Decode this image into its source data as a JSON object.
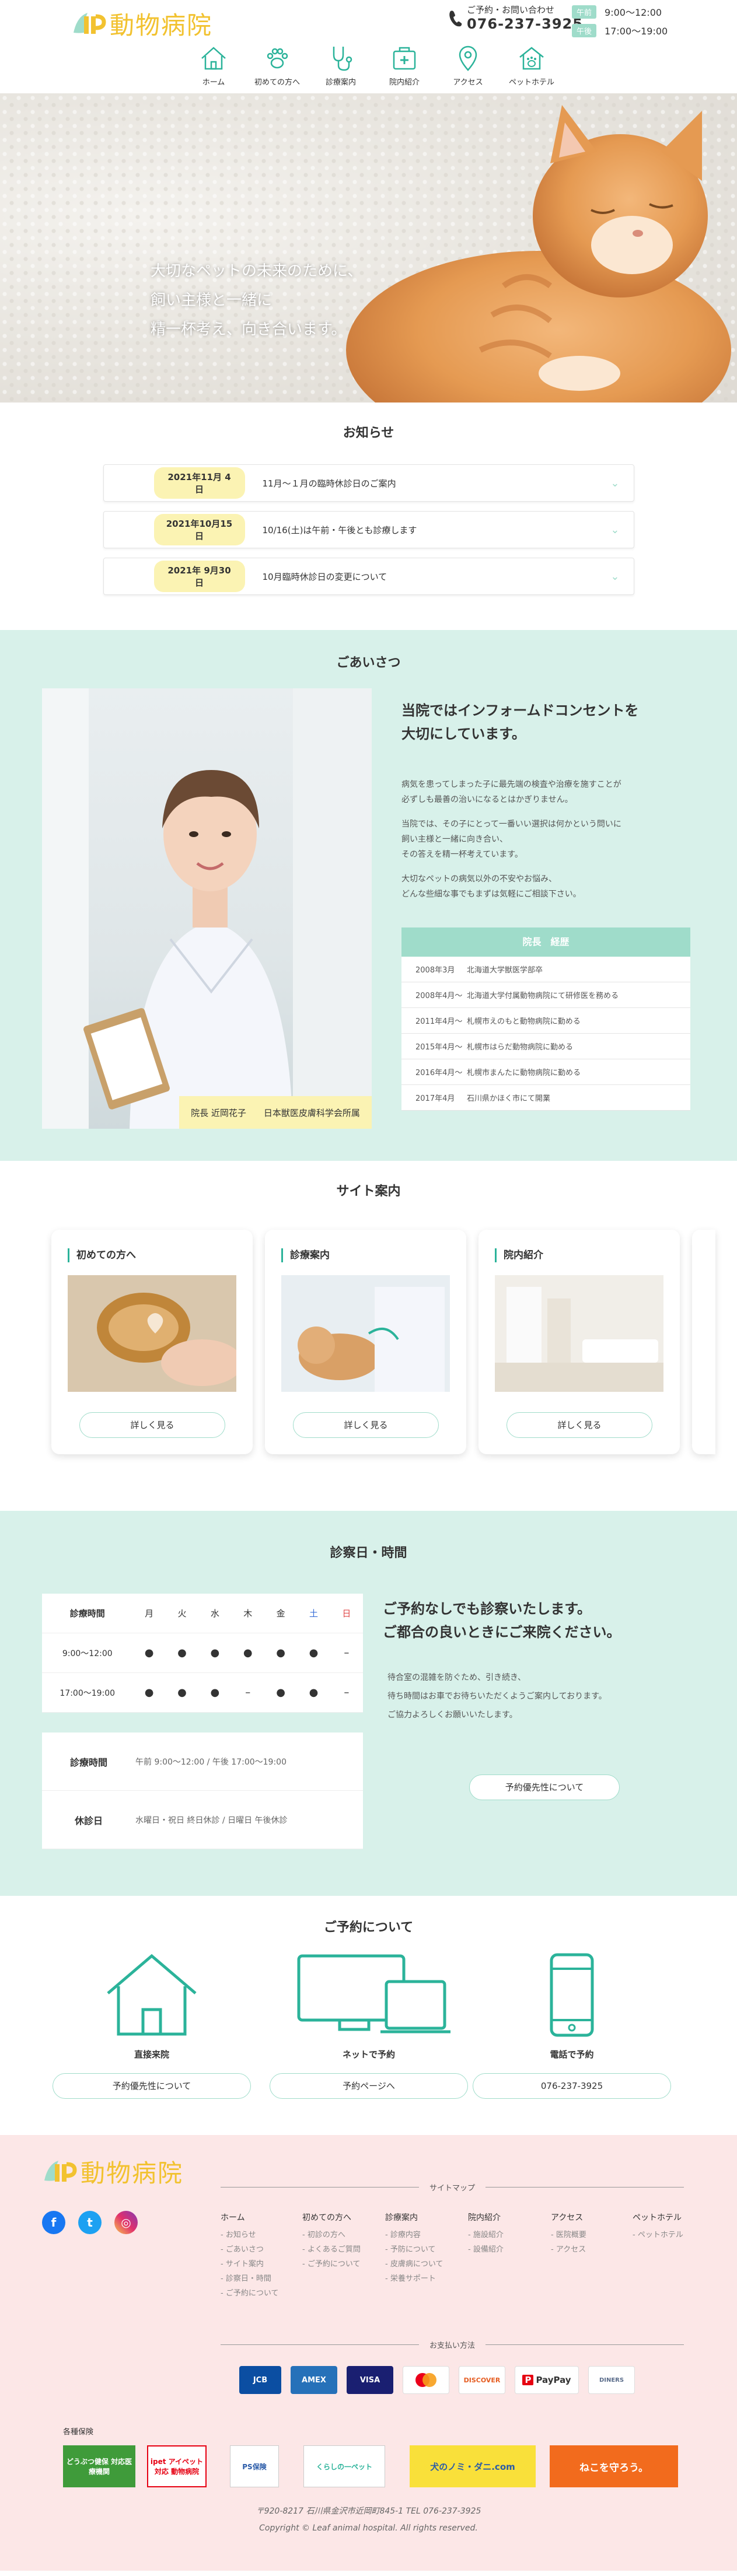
{
  "header": {
    "logo": "動物病院",
    "contact_label": "ご予約・お問い合わせ",
    "phone": "076-237-3925",
    "hours": [
      {
        "tag": "午前",
        "time": "9:00〜12:00"
      },
      {
        "tag": "午後",
        "time": "17:00〜19:00"
      }
    ],
    "nav": [
      {
        "label": "ホーム",
        "icon": "home-icon"
      },
      {
        "label": "初めての方へ",
        "icon": "paw-icon"
      },
      {
        "label": "診療案内",
        "icon": "stethoscope-icon"
      },
      {
        "label": "院内紹介",
        "icon": "clinic-icon"
      },
      {
        "label": "アクセス",
        "icon": "map-pin-icon"
      },
      {
        "label": "ペットホテル",
        "icon": "pet-hotel-icon"
      }
    ]
  },
  "hero": {
    "line1": "大切なペットの未来のために、",
    "line2": "飼い主様と一緒に",
    "line3": "精一杯考え、向き合います。"
  },
  "news": {
    "title": "お知らせ",
    "items": [
      {
        "date": "2021年11月 4日",
        "text": "11月〜１月の臨時休診日のご案内"
      },
      {
        "date": "2021年10月15日",
        "text": "10/16(土)は午前・午後とも診療します"
      },
      {
        "date": "2021年 9月30日",
        "text": "10月臨時休診日の変更について"
      }
    ]
  },
  "greeting": {
    "title": "ごあいさつ",
    "head1": "当院ではインフォームドコンセントを",
    "head2": "大切にしています。",
    "p1a": "病気を患ってしまった子に最先端の検査や治療を施すことが",
    "p1b": "必ずしも最善の治いになるとはかぎりません。",
    "p2a": "当院では、その子にとって一番いい選択は何かという問いに",
    "p2b": "飼い主様と一緒に向き合い、",
    "p2c": "その答えを精一杯考えています。",
    "p3a": "大切なペットの病気以外の不安やお悩み、",
    "p3b": "どんな些細な事でもまずは気軽にご相談下さい。",
    "caption": "院長 近岡花子　　日本獣医皮膚科学会所属",
    "career_title": "院長　経歴",
    "career": [
      {
        "date": "2008年3月",
        "text": "北海道大学獣医学部卒"
      },
      {
        "date": "2008年4月〜",
        "text": "北海道大学付属動物病院にて研修医を務める"
      },
      {
        "date": "2011年4月〜",
        "text": "札幌市えのもと動物病院に勤める"
      },
      {
        "date": "2015年4月〜",
        "text": "札幌市はらだ動物病院に勤める"
      },
      {
        "date": "2016年4月〜",
        "text": "札幌市まんたに動物病院に勤める"
      },
      {
        "date": "2017年4月",
        "text": "石川県かほく市にて開業"
      }
    ]
  },
  "guide": {
    "title": "サイト案内",
    "cards": [
      {
        "title": "初めての方へ",
        "button": "詳しく見る"
      },
      {
        "title": "診療案内",
        "button": "詳しく見る"
      },
      {
        "title": "院内紹介",
        "button": "詳しく見る"
      }
    ]
  },
  "hours": {
    "title": "診察日・時間",
    "header": [
      "診療時間",
      "月",
      "火",
      "水",
      "木",
      "金",
      "土",
      "日"
    ],
    "rows": [
      {
        "label": "9:00〜12:00",
        "cells": [
          "●",
          "●",
          "●",
          "●",
          "●",
          "●",
          "–"
        ]
      },
      {
        "label": "17:00〜19:00",
        "cells": [
          "●",
          "●",
          "●",
          "–",
          "●",
          "●",
          "–"
        ]
      }
    ],
    "info": [
      {
        "key": "診療時間",
        "value": "午前 9:00〜12:00 / 午後 17:00〜19:00"
      },
      {
        "key": "休診日",
        "value": "水曜日・祝日 終日休診 / 日曜日 午後休診"
      }
    ],
    "head1": "ご予約なしでも診察いたします。",
    "head2": "ご都合の良いときにご来院ください。",
    "body1": "待合室の混雑を防ぐため、引き続き、",
    "body2": "待ち時間はお車でお待ちいただくようご案内しております。",
    "body3": "ご協力よろしくお願いいたします。",
    "button": "予約優先性について"
  },
  "reservation": {
    "title": "ご予約について",
    "cols": [
      {
        "label": "直接来院",
        "button": "予約優先性について"
      },
      {
        "label": "ネットで予約",
        "button": "予約ページへ"
      },
      {
        "label": "電話で予約",
        "button": "076-237-3925"
      }
    ]
  },
  "footer": {
    "logo": "動物病院",
    "sitemap_label": "サイトマップ",
    "sitemap": [
      {
        "head": "ホーム",
        "items": [
          "- お知らせ",
          "- ごあいさつ",
          "- サイト案内",
          "- 診察日・時間",
          "- ご予約について"
        ]
      },
      {
        "head": "初めての方へ",
        "items": [
          "- 初診の方へ",
          "- よくあるご質問",
          "- ご予約について"
        ]
      },
      {
        "head": "診療案内",
        "items": [
          "- 診療内容",
          "- 予防について",
          "- 皮膚病について",
          "- 栄養サポート"
        ]
      },
      {
        "head": "院内紹介",
        "items": [
          "- 施設紹介",
          "- 設備紹介"
        ]
      },
      {
        "head": "アクセス",
        "items": [
          "- 医院概要",
          "- アクセス"
        ]
      },
      {
        "head": "ペットホテル",
        "items": [
          "- ペットホテル"
        ]
      }
    ],
    "payment_label": "お支払い方法",
    "payments": [
      "JCB",
      "AMEX",
      "VISA",
      "MC",
      "DISCOVER",
      "PayPay",
      "DINERS"
    ],
    "insurance_label": "各種保険",
    "insurance": [
      "どうぶつ健保 対応医療機関",
      "ipet アイペット対応 動物病院",
      "PS保険",
      "くらしの一ペット",
      "犬のノミ・ダニ.com",
      "ねこを守ろう。"
    ],
    "address": "〒920-8217 石川県金沢市近岡町845-1 TEL 076-237-3925",
    "copyright": "Copyright © Leaf animal hospital. All rights reserved."
  }
}
